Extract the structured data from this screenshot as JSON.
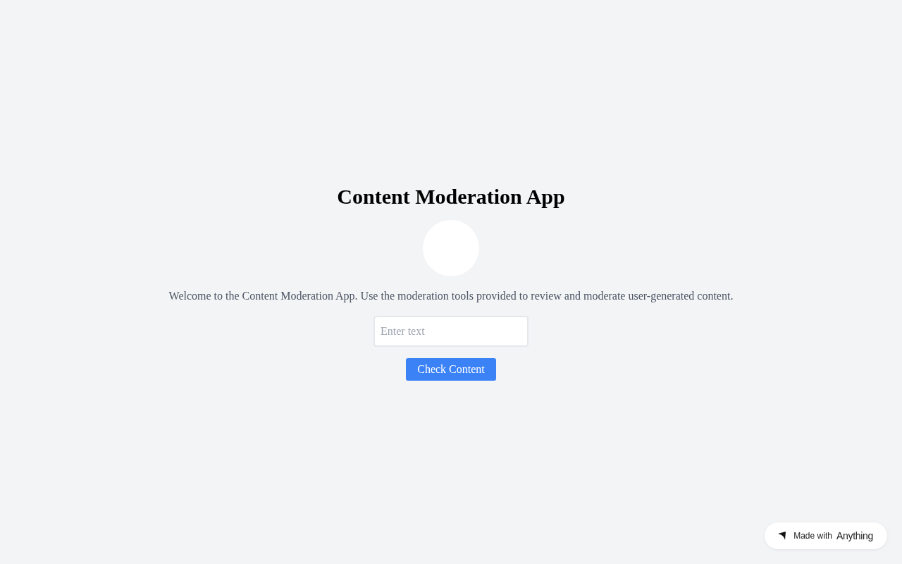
{
  "title": "Content Moderation App",
  "intro": "Welcome to the Content Moderation App. Use the moderation tools provided to review and moderate user-generated content.",
  "input": {
    "placeholder": "Enter text"
  },
  "button": "Check Content",
  "badge": {
    "label": "Made with",
    "brand": "Anything"
  }
}
